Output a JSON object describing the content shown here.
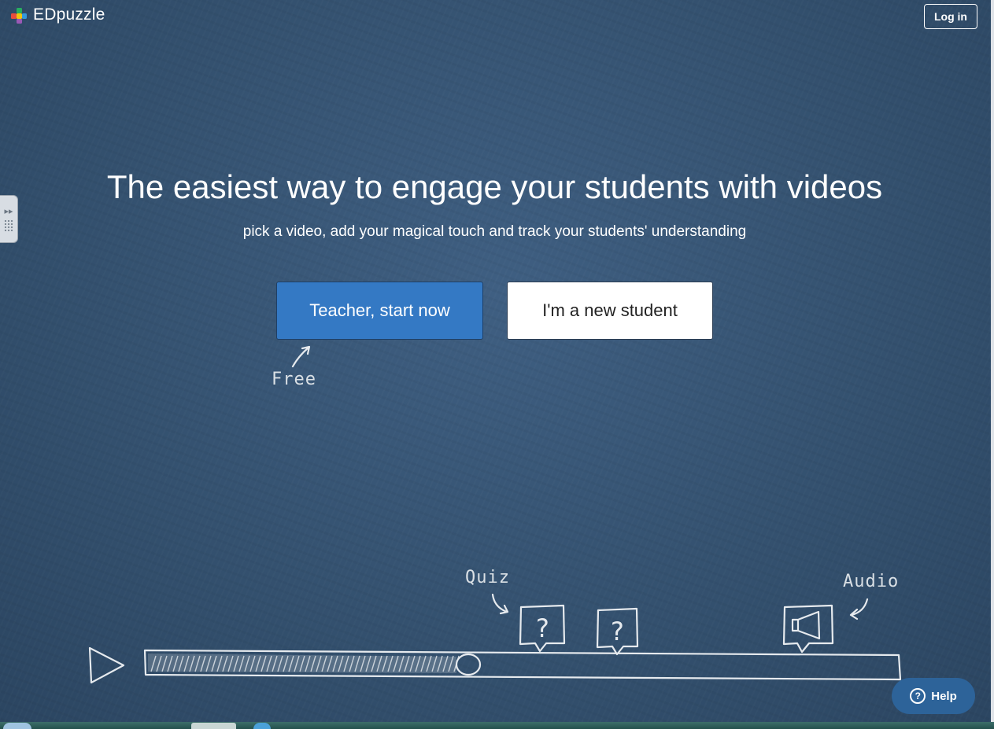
{
  "brand": {
    "name": "EDpuzzle"
  },
  "header": {
    "login_label": "Log in"
  },
  "hero": {
    "title": "The easiest way to engage your students with videos",
    "subtitle": "pick a video, add your magical touch and track your students' understanding"
  },
  "cta": {
    "teacher_label": "Teacher, start now",
    "student_label": "I'm a new student"
  },
  "illustration": {
    "free_note": "Free",
    "quiz_note": "Quiz",
    "audio_note": "Audio",
    "question_mark": "?"
  },
  "help": {
    "label": "Help",
    "icon_glyph": "?"
  },
  "colors": {
    "background": "#34516f",
    "teacher_button": "#3479c4",
    "help_button": "#2d6399"
  }
}
